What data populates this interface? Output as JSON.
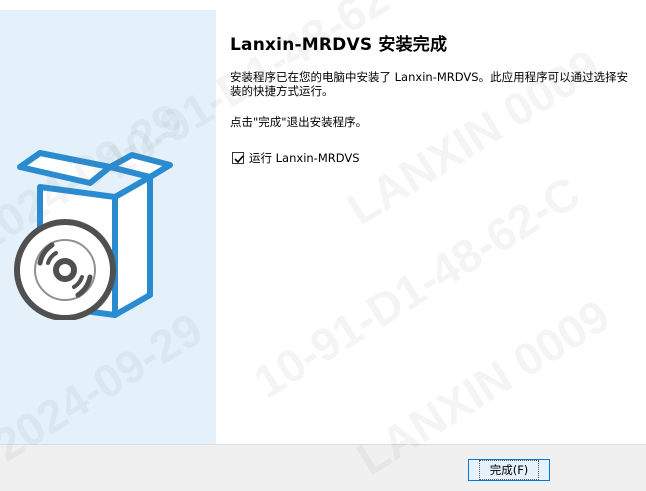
{
  "installer": {
    "heading": "Lanxin-MRDVS 安装完成",
    "paragraph1": "安装程序已在您的电脑中安装了 Lanxin-MRDVS。此应用程序可以通过选择安装的快捷方式运行。",
    "paragraph2": "点击\"完成\"退出安装程序。",
    "run_checkbox": {
      "label": "运行 Lanxin-MRDVS",
      "checked": true
    },
    "finish_button": "完成(F)"
  },
  "watermark": {
    "lines": [
      "10-91-D1-48-62-C",
      "LANXIN  0009",
      "2024-09-29",
      "10-91-D1-48-62-C",
      "LANXIN  0009",
      "2024-09-29"
    ]
  },
  "colors": {
    "left_panel": "#e4f1fb",
    "art_blue": "#2b8bd1",
    "button_border": "#0078d7"
  }
}
